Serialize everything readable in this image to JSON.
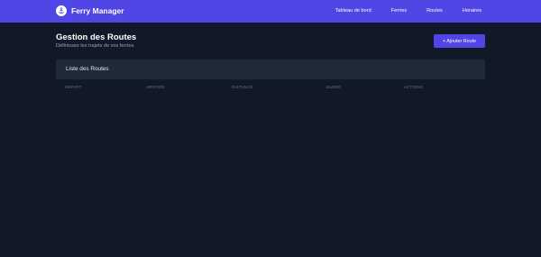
{
  "navbar": {
    "logo_icon": "anchor-icon",
    "brand": "Ferry Manager",
    "links": [
      "Tableau de bord",
      "Ferries",
      "Routes",
      "Horaires"
    ],
    "color": "#4f46e5"
  },
  "header": {
    "title": "Gestion des Routes",
    "subtitle": "Définissez les trajets de vos ferries",
    "add_button": "+ Ajouter Route"
  },
  "card": {
    "title": "Liste des Routes"
  },
  "table": {
    "columns": [
      "DÉPART",
      "ARRIVÉE",
      "DISTANCE",
      "DURÉE",
      "ACTIONS"
    ],
    "rows": []
  }
}
